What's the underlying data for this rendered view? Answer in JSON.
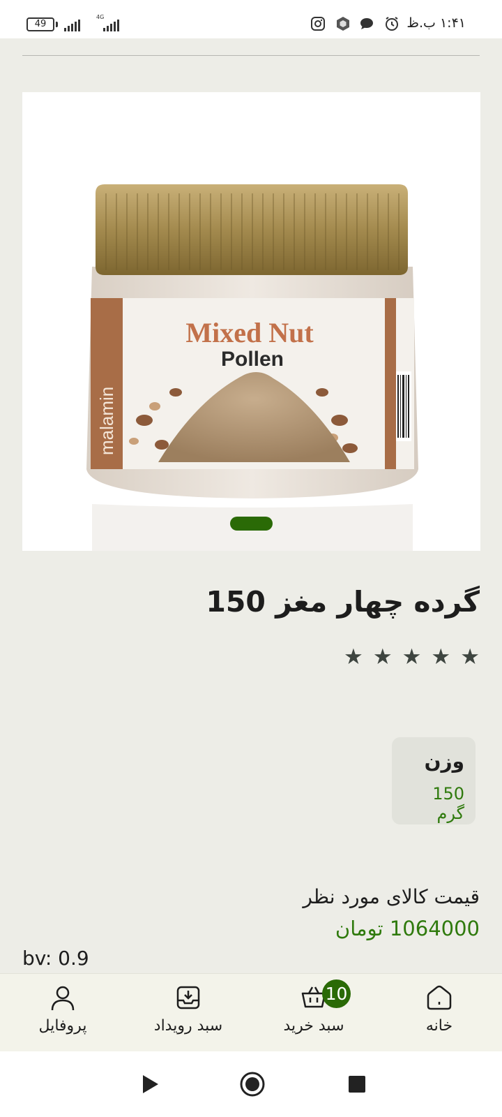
{
  "status_bar": {
    "time": "۱:۴۱ ب.ظ",
    "battery": "49",
    "network": "4G",
    "icons": [
      "instagram-icon",
      "hexagon-app-icon",
      "chat-bubble-icon",
      "alarm-icon"
    ]
  },
  "product": {
    "image_alt": "Mixed Nut Pollen",
    "image_brand": "malamin",
    "image_title_line1": "Mixed Nut",
    "image_title_line2": "Pollen",
    "title": "گرده چهار مغز 150",
    "rating": 5,
    "stars": [
      "★",
      "★",
      "★",
      "★",
      "★"
    ]
  },
  "spec": {
    "label": "وزن",
    "value": "150 گرم"
  },
  "price": {
    "label": "قیمت کالای مورد نظر",
    "value": "1064000 تومان"
  },
  "bv": "bv: 0.9",
  "bottom_nav": {
    "items": [
      {
        "label": "خانه",
        "icon": "home-icon"
      },
      {
        "label": "سبد خرید",
        "icon": "basket-icon",
        "badge": "10"
      },
      {
        "label": "سبد رویداد",
        "icon": "event-tray-icon"
      },
      {
        "label": "پروفایل",
        "icon": "person-icon"
      }
    ]
  },
  "colors": {
    "accent": "#2a6a06",
    "price": "#2f7a0d",
    "background": "#ededE7",
    "nav_background": "#f3f3ea"
  }
}
